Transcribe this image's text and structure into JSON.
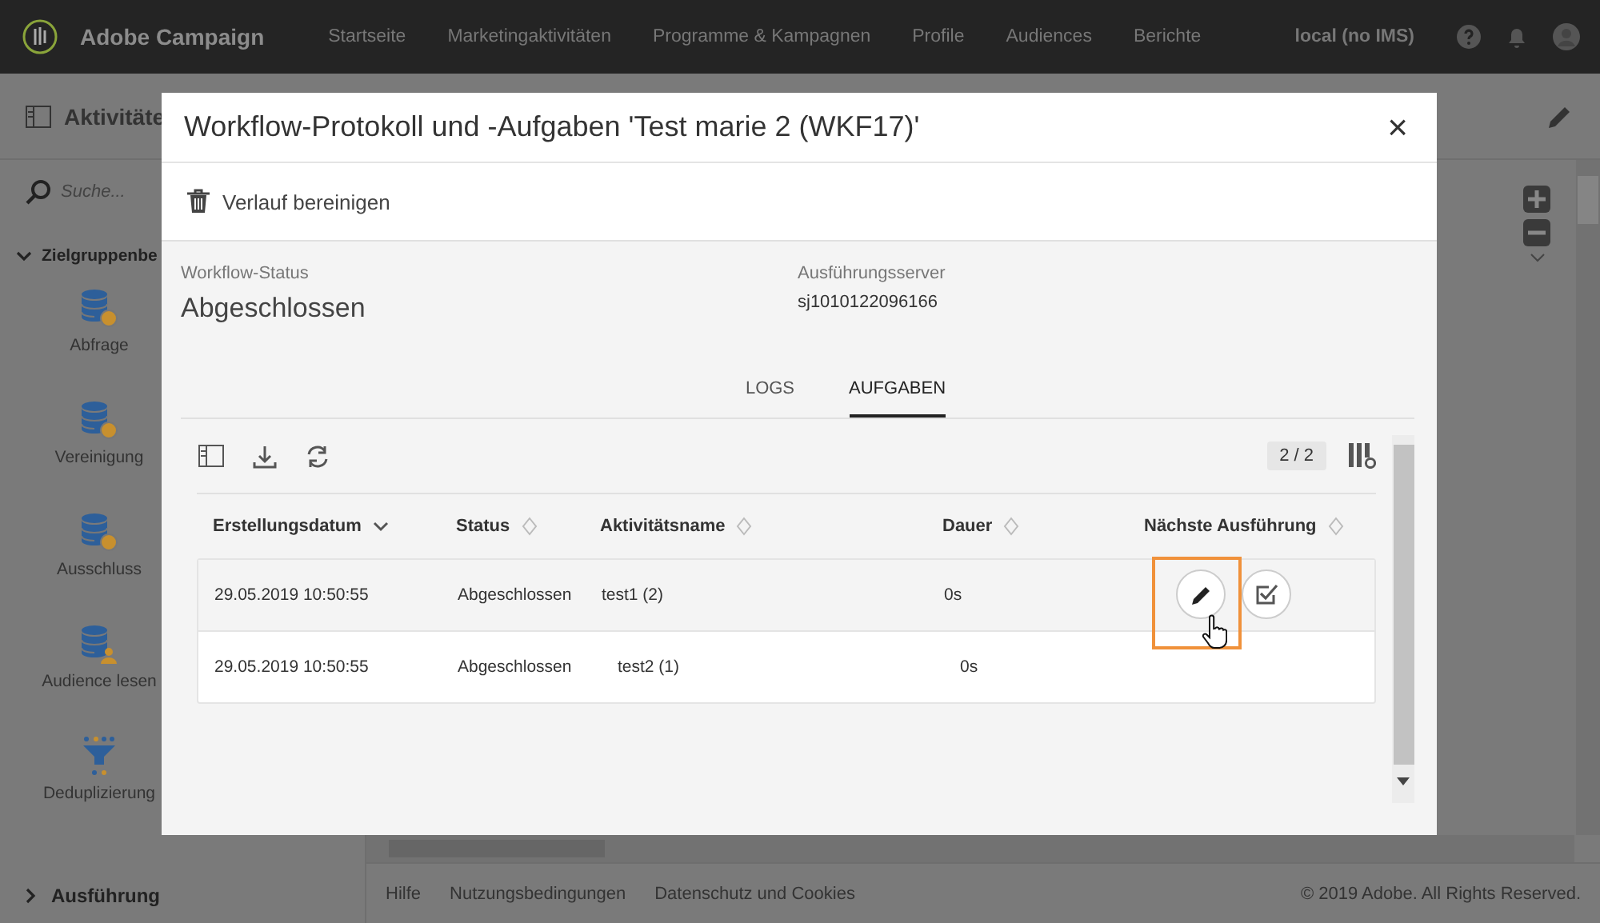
{
  "topbar": {
    "brand": "Adobe Campaign",
    "nav": [
      {
        "label": "Startseite",
        "selected": false
      },
      {
        "label": "Marketingaktivitäten",
        "selected": false
      },
      {
        "label": "Programme & Kampagnen",
        "selected": false
      },
      {
        "label": "Profile",
        "selected": false
      },
      {
        "label": "Audiences",
        "selected": false
      },
      {
        "label": "Berichte",
        "selected": false
      }
    ],
    "user": "local (no IMS)"
  },
  "page_header": {
    "title": "Aktivitäte"
  },
  "sidebar": {
    "search": {
      "placeholder": "Suche..."
    },
    "group": {
      "label": "Zielgruppenbe",
      "expanded": true
    },
    "items": [
      {
        "label": "Abfrage",
        "kind": "query"
      },
      {
        "label": "Vereinigung",
        "kind": "union"
      },
      {
        "label": "Ausschluss",
        "kind": "exclusion"
      },
      {
        "label": "Audience lesen",
        "kind": "audience"
      },
      {
        "label": "Deduplizierung",
        "kind": "dedup"
      }
    ],
    "group_2": {
      "label": "Ausführung",
      "expanded": false
    }
  },
  "footer": {
    "links": [
      "Hilfe",
      "Nutzungsbedingungen",
      "Datenschutz und Cookies"
    ],
    "copyright": "© 2019 Adobe. All Rights Reserved."
  },
  "dialog": {
    "title": "Workflow-Protokoll und -Aufgaben 'Test marie 2 (WKF17)'",
    "close": "×",
    "toolbar_action": "Verlauf bereinigen",
    "fields": [
      {
        "label": "Workflow-Status",
        "value": "Abgeschlossen",
        "kind": "large"
      },
      {
        "label": "Ausführungsserver",
        "value": "sj1010122096166",
        "kind": "small"
      }
    ],
    "tabs": [
      {
        "label": "LOGS",
        "selected": false
      },
      {
        "label": "AUFGABEN",
        "selected": true
      }
    ],
    "table": {
      "count": "2 / 2",
      "columns": [
        {
          "label": "Erstellungsdatum",
          "sorted": true
        },
        {
          "label": "Status",
          "sorted": false
        },
        {
          "label": "Aktivitätsname",
          "sorted": false
        },
        {
          "label": "Dauer",
          "sorted": false
        },
        {
          "label": "Nächste Ausführung",
          "sorted": false
        }
      ],
      "rows": [
        {
          "cells": [
            "29.05.2019 10:50:55",
            "Abgeschlossen",
            "test1 (2)",
            "0s"
          ],
          "actions": true,
          "indent": false
        },
        {
          "cells": [
            "29.05.2019 10:50:55",
            "Abgeschlossen",
            "test2 (1)",
            "0s"
          ],
          "actions": false,
          "indent": true
        }
      ]
    }
  }
}
